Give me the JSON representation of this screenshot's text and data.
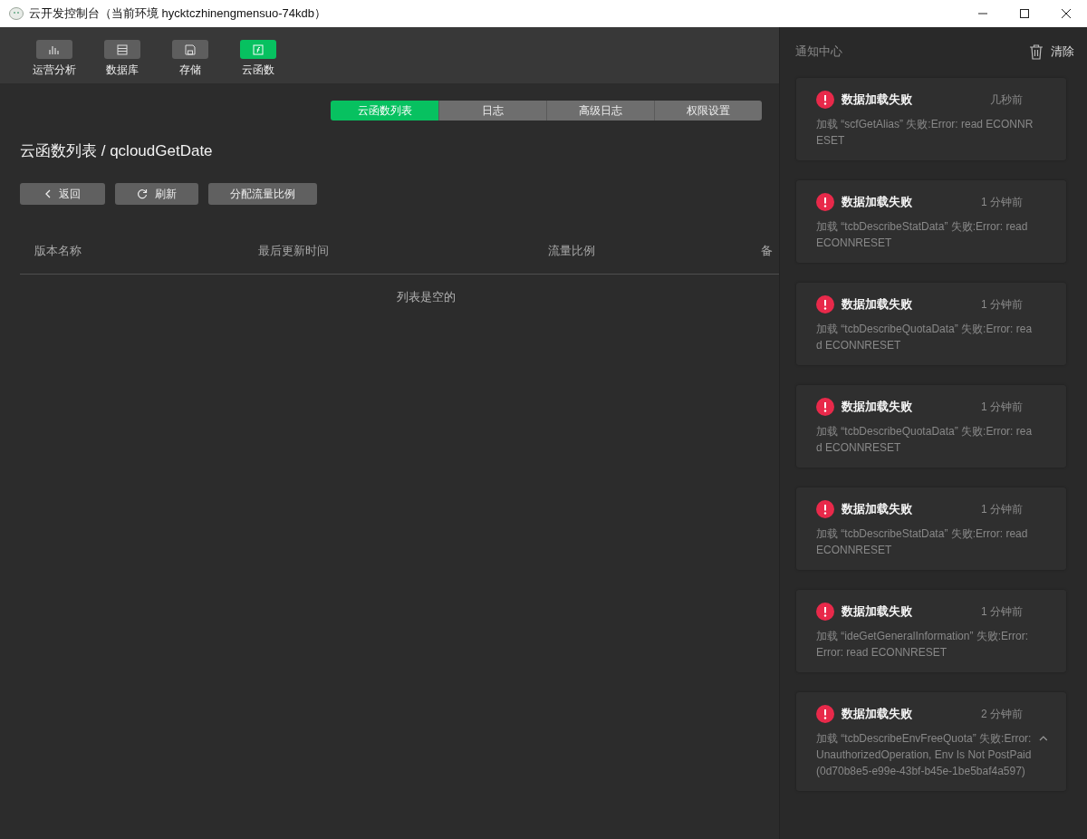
{
  "window": {
    "title": "云开发控制台（当前环境 hycktczhinengmensuo-74kdb）"
  },
  "toolbar": [
    {
      "label": "运营分析",
      "kind": "chart",
      "selected": false
    },
    {
      "label": "数据库",
      "kind": "table",
      "selected": false
    },
    {
      "label": "存储",
      "kind": "disk",
      "selected": false
    },
    {
      "label": "云函数",
      "kind": "function",
      "selected": true
    }
  ],
  "tabs": [
    {
      "label": "云函数列表",
      "selected": true
    },
    {
      "label": "日志",
      "selected": false
    },
    {
      "label": "高级日志",
      "selected": false
    },
    {
      "label": "权限设置",
      "selected": false
    }
  ],
  "heading": "云函数列表 / qcloudGetDate",
  "buttons": [
    {
      "label": "返回",
      "kind": "back"
    },
    {
      "label": "刷新",
      "kind": "refresh"
    },
    {
      "label": "分配流量比例",
      "kind": "plain"
    }
  ],
  "table": {
    "columns": [
      "版本名称",
      "最后更新时间",
      "流量比例",
      "备"
    ],
    "empty_text": "列表是空的"
  },
  "notifications": {
    "title": "通知中心",
    "clear": "清除",
    "items": [
      {
        "title": "数据加载失败",
        "time": "几秒前",
        "message": "加载 “scfGetAlias” 失败:Error: read ECONNRESET",
        "expanded": false
      },
      {
        "title": "数据加载失败",
        "time": "1 分钟前",
        "message": "加载 “tcbDescribeStatData” 失败:Error: read ECONNRESET",
        "expanded": false
      },
      {
        "title": "数据加载失败",
        "time": "1 分钟前",
        "message": "加载 “tcbDescribeQuotaData” 失败:Error: read ECONNRESET",
        "expanded": false
      },
      {
        "title": "数据加载失败",
        "time": "1 分钟前",
        "message": "加载 “tcbDescribeQuotaData” 失败:Error: read ECONNRESET",
        "expanded": false
      },
      {
        "title": "数据加载失败",
        "time": "1 分钟前",
        "message": "加载 “tcbDescribeStatData” 失败:Error: read ECONNRESET",
        "expanded": false
      },
      {
        "title": "数据加载失败",
        "time": "1 分钟前",
        "message": "加载 “ideGetGeneralInformation” 失败:Error: Error: read ECONNRESET",
        "expanded": false
      },
      {
        "title": "数据加载失败",
        "time": "2 分钟前",
        "message": "加载 “tcbDescribeEnvFreeQuota” 失败:Error: UnauthorizedOperation, Env Is Not PostPaid (0d70b8e5-e99e-43bf-b45e-1be5baf4a597)",
        "expanded": true
      }
    ]
  }
}
